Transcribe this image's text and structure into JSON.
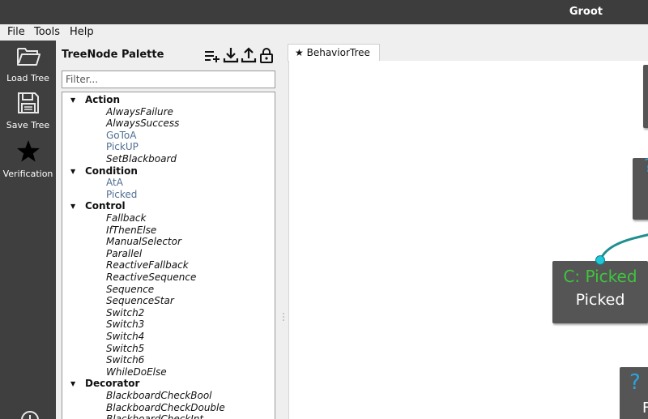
{
  "window": {
    "title": "Groot"
  },
  "menu": {
    "file": "File",
    "tools": "Tools",
    "help": "Help"
  },
  "toolbar": {
    "load_tree": "Load Tree",
    "save_tree": "Save Tree",
    "verification": "Verification"
  },
  "palette": {
    "title": "TreeNode Palette",
    "filter_placeholder": "Filter...",
    "categories": [
      {
        "name": "Action",
        "items": [
          "AlwaysFailure",
          "AlwaysSuccess",
          "GoToA",
          "PickUP",
          "SetBlackboard"
        ]
      },
      {
        "name": "Condition",
        "items": [
          "AtA",
          "Picked"
        ]
      },
      {
        "name": "Control",
        "items": [
          "Fallback",
          "IfThenElse",
          "ManualSelector",
          "Parallel",
          "ReactiveFallback",
          "ReactiveSequence",
          "Sequence",
          "SequenceStar",
          "Switch2",
          "Switch3",
          "Switch4",
          "Switch5",
          "Switch6",
          "WhileDoElse"
        ]
      },
      {
        "name": "Decorator",
        "items": [
          "BlackboardCheckBool",
          "BlackboardCheckDouble",
          "BlackboardCheckInt"
        ]
      }
    ]
  },
  "tabs": [
    {
      "label": "BehaviorTree"
    }
  ],
  "canvas": {
    "node_picked": {
      "type_label": "C: Picked",
      "name": "Picked"
    },
    "node_bottom": {
      "label": "?",
      "sub": "F"
    },
    "node_top_mid": {
      "label": "?"
    }
  },
  "colors": {
    "custom_node_text": "#4f6f93",
    "condition_green": "#3fc43f",
    "connector_teal": "#1f8f8f",
    "port_cyan": "#1ec8d8"
  }
}
